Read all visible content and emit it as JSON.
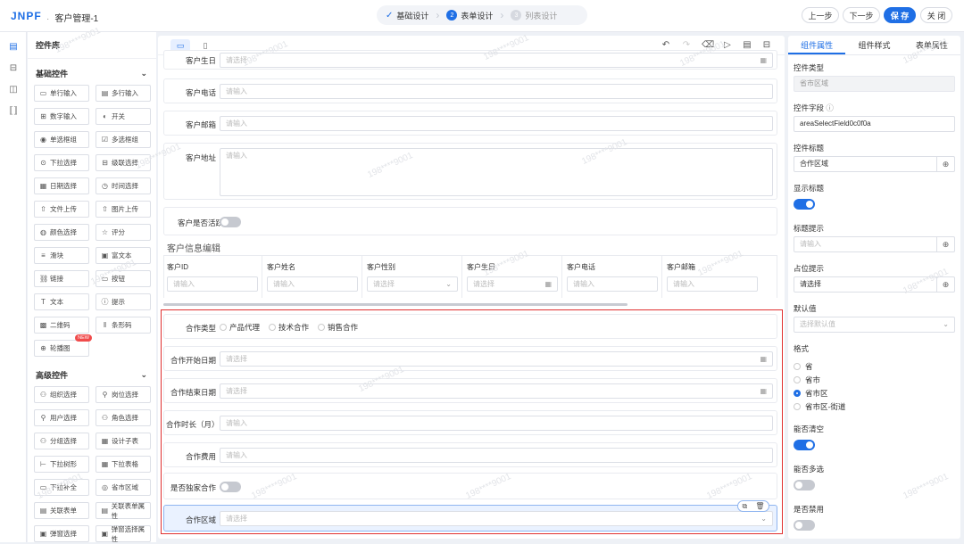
{
  "app": {
    "logo": "JNPF",
    "title": "客户管理-1"
  },
  "steps": [
    {
      "label": "基础设计"
    },
    {
      "num": "2",
      "label": "表单设计"
    },
    {
      "num": "3",
      "label": "列表设计"
    }
  ],
  "actions": {
    "prev": "上一步",
    "next": "下一步",
    "save": "保 存",
    "close": "关 闭"
  },
  "library": {
    "title": "控件库",
    "basic_title": "基础控件",
    "basic": [
      {
        "label": "单行输入",
        "icon": "▭"
      },
      {
        "label": "多行输入",
        "icon": "▤"
      },
      {
        "label": "数字输入",
        "icon": "⊞"
      },
      {
        "label": "开关",
        "icon": "◐"
      },
      {
        "label": "单选框组",
        "icon": "◉"
      },
      {
        "label": "多选框组",
        "icon": "☑"
      },
      {
        "label": "下拉选择",
        "icon": "⊙"
      },
      {
        "label": "级联选择",
        "icon": "⊟"
      },
      {
        "label": "日期选择",
        "icon": "▦"
      },
      {
        "label": "时间选择",
        "icon": "◷"
      },
      {
        "label": "文件上传",
        "icon": "⇧"
      },
      {
        "label": "图片上传",
        "icon": "⇧"
      },
      {
        "label": "颜色选择",
        "icon": "◍"
      },
      {
        "label": "评分",
        "icon": "☆"
      },
      {
        "label": "滑块",
        "icon": "≡"
      },
      {
        "label": "富文本",
        "icon": "▣"
      },
      {
        "label": "链接",
        "icon": "⛓"
      },
      {
        "label": "按钮",
        "icon": "▭"
      },
      {
        "label": "文本",
        "icon": "T"
      },
      {
        "label": "提示",
        "icon": "ⓘ"
      },
      {
        "label": "二维码",
        "icon": "▩"
      },
      {
        "label": "条形码",
        "icon": "‖"
      },
      {
        "label": "轮播图",
        "icon": "⊕",
        "badge": "NEW"
      }
    ],
    "advanced_title": "高级控件",
    "advanced": [
      {
        "label": "组织选择",
        "icon": "⚇"
      },
      {
        "label": "岗位选择",
        "icon": "⚲"
      },
      {
        "label": "用户选择",
        "icon": "⚲"
      },
      {
        "label": "角色选择",
        "icon": "⚇"
      },
      {
        "label": "分组选择",
        "icon": "⚇"
      },
      {
        "label": "设计子表",
        "icon": "▦"
      },
      {
        "label": "下拉树形",
        "icon": "⊢"
      },
      {
        "label": "下拉表格",
        "icon": "▦"
      },
      {
        "label": "下拉补全",
        "icon": "▭"
      },
      {
        "label": "省市区域",
        "icon": "◎"
      },
      {
        "label": "关联表单",
        "icon": "▤"
      },
      {
        "label": "关联表单属性",
        "icon": "▤"
      },
      {
        "label": "弹窗选择",
        "icon": "▣"
      },
      {
        "label": "弹窗选择属性",
        "icon": "▣"
      }
    ]
  },
  "canvas": {
    "birthday": {
      "label": "客户生日",
      "placeholder": "请选择"
    },
    "phone": {
      "label": "客户电话",
      "placeholder": "请输入"
    },
    "email": {
      "label": "客户邮箱",
      "placeholder": "请输入"
    },
    "address": {
      "label": "客户地址",
      "placeholder": "请输入"
    },
    "active": {
      "label": "客户是否活跃"
    },
    "subtable": {
      "title": "客户信息编辑",
      "columns": [
        {
          "label": "客户ID",
          "placeholder": "请输入"
        },
        {
          "label": "客户姓名",
          "placeholder": "请输入"
        },
        {
          "label": "客户性别",
          "placeholder": "请选择"
        },
        {
          "label": "客户生日",
          "placeholder": "请选择"
        },
        {
          "label": "客户电话",
          "placeholder": "请输入"
        },
        {
          "label": "客户邮箱",
          "placeholder": "请输入"
        }
      ]
    },
    "coop_type": {
      "label": "合作类型",
      "options": [
        "产品代理",
        "技术合作",
        "销售合作"
      ]
    },
    "start_date": {
      "label": "合作开始日期",
      "placeholder": "请选择"
    },
    "end_date": {
      "label": "合作结束日期",
      "placeholder": "请选择"
    },
    "duration": {
      "label": "合作时长（月）",
      "placeholder": "请输入"
    },
    "fee": {
      "label": "合作费用",
      "placeholder": "请输入"
    },
    "exclusive": {
      "label": "是否独家合作"
    },
    "region": {
      "label": "合作区域",
      "placeholder": "请选择"
    }
  },
  "props": {
    "tabs": [
      "组件属性",
      "组件样式",
      "表单属性"
    ],
    "type_label": "控件类型",
    "type_value": "省市区域",
    "field_label": "控件字段",
    "field_value": "areaSelectField0c0f0a",
    "title_label": "控件标题",
    "title_value": "合作区域",
    "show_title_label": "显示标题",
    "tip_label": "标题提示",
    "tip_placeholder": "请输入",
    "placeholder_label": "占位提示",
    "placeholder_value": "请选择",
    "default_label": "默认值",
    "default_placeholder": "选择默认值",
    "format_label": "格式",
    "formats": [
      "省",
      "省市",
      "省市区",
      "省市区-街道"
    ],
    "clearable_label": "能否清空",
    "multiple_label": "能否多选",
    "disabled_label": "是否禁用"
  },
  "watermark": "198****9001",
  "colors": {
    "primary": "#1f6fe5",
    "selection": "#e03030"
  }
}
